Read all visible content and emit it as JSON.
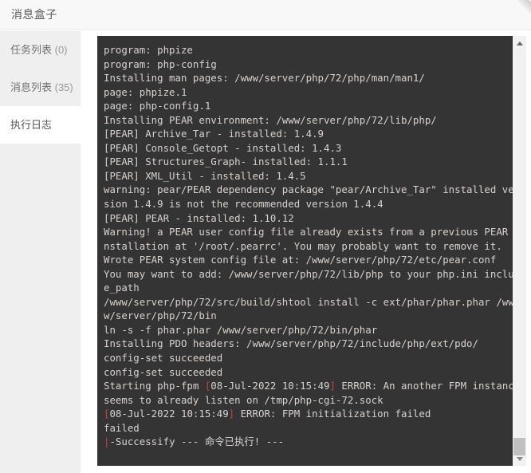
{
  "header": {
    "title": "消息盒子"
  },
  "sidebar": {
    "items": [
      {
        "label": "任务列表",
        "count": "(0)",
        "active": false,
        "name": "sidebar-item-task-list"
      },
      {
        "label": "消息列表",
        "count": "(35)",
        "active": false,
        "name": "sidebar-item-message-list"
      },
      {
        "label": "执行日志",
        "count": "",
        "active": true,
        "name": "sidebar-item-execution-log"
      }
    ]
  },
  "console": {
    "lines": [
      [
        {
          "t": "program: phpize"
        }
      ],
      [
        {
          "t": "program: php-config"
        }
      ],
      [
        {
          "t": "Installing man pages: /www/server/php/72/php/man/man1/"
        }
      ],
      [
        {
          "t": "page: phpize.1"
        }
      ],
      [
        {
          "t": "page: php-config.1"
        }
      ],
      [
        {
          "t": "Installing PEAR environment: /www/server/php/72/lib/php/"
        }
      ],
      [
        {
          "t": "[PEAR] Archive_Tar - installed: 1.4.9"
        }
      ],
      [
        {
          "t": "[PEAR] Console_Getopt - installed: 1.4.3"
        }
      ],
      [
        {
          "t": "[PEAR] Structures_Graph- installed: 1.1.1"
        }
      ],
      [
        {
          "t": "[PEAR] XML_Util - installed: 1.4.5"
        }
      ],
      [
        {
          "t": "warning: pear/PEAR dependency package \"pear/Archive_Tar\" installed ver"
        }
      ],
      [
        {
          "t": "sion 1.4.9 is not the recommended version 1.4.4"
        }
      ],
      [
        {
          "t": "[PEAR] PEAR - installed: 1.10.12"
        }
      ],
      [
        {
          "t": "Warning! a PEAR user config file already exists from a previous PEAR i"
        }
      ],
      [
        {
          "t": "nstallation at '/root/.pearrc'. You may probably want to remove it."
        }
      ],
      [
        {
          "t": "Wrote PEAR system config file at: /www/server/php/72/etc/pear.conf"
        }
      ],
      [
        {
          "t": "You may want to add: /www/server/php/72/lib/php to your php.ini includ"
        }
      ],
      [
        {
          "t": "e_path"
        }
      ],
      [
        {
          "t": "/www/server/php/72/src/build/shtool install -c ext/phar/phar.phar /ww"
        }
      ],
      [
        {
          "t": "w/server/php/72/bin"
        }
      ],
      [
        {
          "t": "ln -s -f phar.phar /www/server/php/72/bin/phar"
        }
      ],
      [
        {
          "t": "Installing PDO headers: /www/server/php/72/include/php/ext/pdo/"
        }
      ],
      [
        {
          "t": "config-set succeeded"
        }
      ],
      [
        {
          "t": "config-set succeeded"
        }
      ],
      [
        {
          "t": "Starting php-fpm "
        },
        {
          "t": "[",
          "c": "red"
        },
        {
          "t": "08-Jul-2022 10:15:49"
        },
        {
          "t": "]",
          "c": "red"
        },
        {
          "t": " ERROR: An another FPM instance"
        }
      ],
      [
        {
          "t": "seems to already listen on /tmp/php-cgi-72.sock"
        }
      ],
      [
        {
          "t": "[",
          "c": "red"
        },
        {
          "t": "08-Jul-2022 10:15:49"
        },
        {
          "t": "]",
          "c": "red"
        },
        {
          "t": " ERROR: FPM initialization failed"
        }
      ],
      [
        {
          "t": "failed"
        }
      ],
      [
        {
          "t": "|",
          "c": "red"
        },
        {
          "t": "-Successify --- 命令已执行! ---"
        }
      ]
    ]
  },
  "scrollbar": {
    "up_label": "▲",
    "down_label": "▼"
  }
}
